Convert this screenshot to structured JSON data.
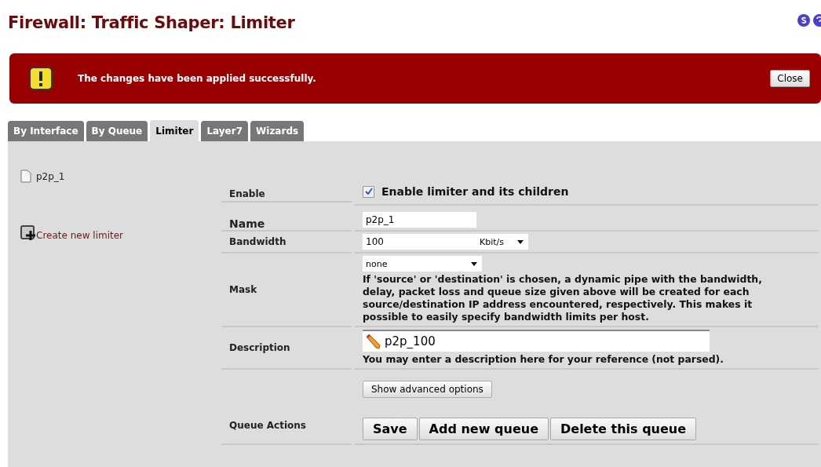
{
  "page_title": "Firewall: Traffic Shaper: Limiter",
  "alert": {
    "message": "The changes have been applied successfully.",
    "close": "Close"
  },
  "tabs": [
    {
      "label": "By Interface",
      "selected": false
    },
    {
      "label": "By Queue",
      "selected": false
    },
    {
      "label": "Limiter",
      "selected": true
    },
    {
      "label": "Layer7",
      "selected": false
    },
    {
      "label": "Wizards",
      "selected": false
    }
  ],
  "sidebar": {
    "items": [
      {
        "label": "p2p_1"
      }
    ],
    "create": "Create new limiter"
  },
  "form": {
    "enable": {
      "label": "Enable",
      "text": "Enable limiter and its children",
      "checked": true
    },
    "name": {
      "label": "Name",
      "value": "p2p_1"
    },
    "bandwidth": {
      "label": "Bandwidth",
      "value": "100",
      "unit": "Kbit/s"
    },
    "mask": {
      "label": "Mask",
      "value": "none",
      "help": "If 'source' or 'destination' is chosen, a dynamic pipe with the bandwidth, delay, packet loss and queue size given above will be created for each source/destination IP address encountered, respectively. This makes it possible to easily specify bandwidth limits per host."
    },
    "description": {
      "label": "Description",
      "value": "p2p_100",
      "help": "You may enter a description here for your reference (not parsed)."
    },
    "advanced": "Show advanced options",
    "actions": {
      "label": "Queue Actions",
      "buttons": [
        "Save",
        "Add new queue",
        "Delete this queue"
      ]
    }
  }
}
